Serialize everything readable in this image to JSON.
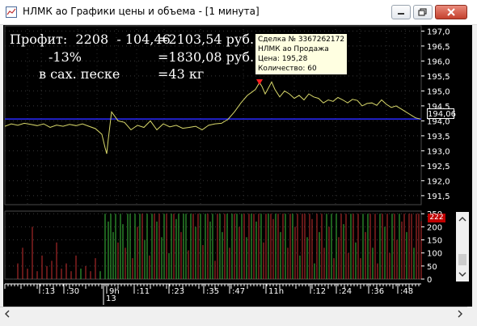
{
  "window": {
    "title": "НЛМК ао Графики цены и объема - [1 минута]"
  },
  "stats": {
    "line1_left": "Профит:  2208  - 104,46",
    "line1_right": "=2103,54 руб.",
    "line2_left": "-13%",
    "line2_right": "=1830,08 руб.",
    "line3_left": "в сах. песке",
    "line3_right": "=43 кг"
  },
  "tooltip": {
    "deal": "Сделка № 3367262172",
    "instrument": "НЛМК ао Продажа",
    "price": "Цена: 195,28",
    "quantity": "Количество: 60"
  },
  "price_axis": {
    "ticks": [
      "197,0",
      "196,5",
      "196,0",
      "195,5",
      "195,0",
      "194,5",
      "194,0",
      "193,5",
      "193,0",
      "192,5",
      "192,0",
      "191,5"
    ],
    "current": "194,06"
  },
  "volume_axis": {
    "ticks": [
      "250",
      "200",
      "150",
      "100",
      "50",
      "0"
    ],
    "current": "222"
  },
  "time_axis": {
    "labels": [
      ":13",
      ":30",
      "9h",
      ":11",
      ":23",
      ":35",
      ":47",
      "11h",
      ":12",
      ":24",
      ":36",
      ":48"
    ],
    "day": "13"
  },
  "colors": {
    "background": "#000000",
    "price_line": "#d8d86a",
    "reference_line": "#2a2aff",
    "volume_buy": "#3cc03c",
    "volume_sell": "#c83030",
    "tooltip_bg": "#ffffe1"
  },
  "chart_data": {
    "type": "line",
    "price": {
      "ylim": [
        191.2,
        197.2
      ],
      "reference": 194.06,
      "marker": 195.28,
      "x": [
        0,
        8,
        16,
        24,
        32,
        40,
        48,
        56,
        64,
        72,
        80,
        88,
        96,
        104,
        112,
        120,
        124,
        126,
        128,
        132,
        136,
        140,
        148,
        156,
        164,
        172,
        180,
        188,
        196,
        204,
        212,
        220,
        228,
        236,
        244,
        252,
        260,
        268,
        276,
        284,
        292,
        300,
        305,
        310,
        315,
        318,
        322,
        326,
        330,
        334,
        340,
        346,
        352,
        358,
        364,
        370,
        376,
        382,
        388,
        394,
        400,
        406,
        412,
        418,
        424,
        430,
        436,
        442,
        448,
        454,
        460,
        466,
        472,
        478,
        484,
        490,
        496,
        502,
        508,
        514
      ],
      "values": [
        193.82,
        193.9,
        193.85,
        193.92,
        193.88,
        193.84,
        193.9,
        193.78,
        193.86,
        193.82,
        193.88,
        193.84,
        193.9,
        193.82,
        193.74,
        193.55,
        193.1,
        192.9,
        193.4,
        194.3,
        194.15,
        194.0,
        193.95,
        193.7,
        193.85,
        193.78,
        194.0,
        193.7,
        193.9,
        193.8,
        193.85,
        193.75,
        193.78,
        193.82,
        193.7,
        193.85,
        193.9,
        193.92,
        194.05,
        194.3,
        194.6,
        194.85,
        194.95,
        195.05,
        195.28,
        195.15,
        194.9,
        195.1,
        195.3,
        195.05,
        194.8,
        195.0,
        194.9,
        194.75,
        194.85,
        194.7,
        194.9,
        194.8,
        194.75,
        194.6,
        194.7,
        194.65,
        194.78,
        194.7,
        194.6,
        194.72,
        194.68,
        194.5,
        194.58,
        194.6,
        194.52,
        194.7,
        194.55,
        194.45,
        194.5,
        194.4,
        194.3,
        194.2,
        194.1,
        194.06
      ]
    },
    "volume": {
      "ylim": [
        0,
        260
      ],
      "bars": [
        [
          16,
          60,
          "s"
        ],
        [
          22,
          120,
          "s"
        ],
        [
          28,
          40,
          "s"
        ],
        [
          34,
          200,
          "s"
        ],
        [
          40,
          30,
          "s"
        ],
        [
          46,
          90,
          "s"
        ],
        [
          52,
          50,
          "s"
        ],
        [
          58,
          70,
          "s"
        ],
        [
          64,
          140,
          "s"
        ],
        [
          70,
          40,
          "s"
        ],
        [
          76,
          60,
          "s"
        ],
        [
          82,
          30,
          "s"
        ],
        [
          88,
          90,
          "s"
        ],
        [
          94,
          40,
          "b"
        ],
        [
          100,
          50,
          "s"
        ],
        [
          106,
          30,
          "s"
        ],
        [
          112,
          80,
          "s"
        ],
        [
          118,
          30,
          "b"
        ],
        [
          124,
          250,
          "b"
        ],
        [
          128,
          220,
          "b"
        ],
        [
          131,
          250,
          "b"
        ],
        [
          134,
          180,
          "b"
        ],
        [
          137,
          250,
          "b"
        ],
        [
          140,
          140,
          "s"
        ],
        [
          143,
          250,
          "b"
        ],
        [
          146,
          210,
          "b"
        ],
        [
          149,
          120,
          "s"
        ],
        [
          152,
          250,
          "b"
        ],
        [
          155,
          250,
          "b"
        ],
        [
          158,
          80,
          "s"
        ],
        [
          161,
          250,
          "b"
        ],
        [
          164,
          200,
          "s"
        ],
        [
          167,
          250,
          "b"
        ],
        [
          170,
          250,
          "s"
        ],
        [
          173,
          150,
          "b"
        ],
        [
          176,
          250,
          "b"
        ],
        [
          179,
          90,
          "s"
        ],
        [
          182,
          250,
          "b"
        ],
        [
          185,
          250,
          "s"
        ],
        [
          188,
          220,
          "b"
        ],
        [
          191,
          250,
          "s"
        ],
        [
          194,
          160,
          "b"
        ],
        [
          197,
          250,
          "b"
        ],
        [
          200,
          250,
          "s"
        ],
        [
          203,
          100,
          "b"
        ],
        [
          206,
          250,
          "b"
        ],
        [
          209,
          250,
          "s"
        ],
        [
          212,
          230,
          "b"
        ],
        [
          215,
          250,
          "b"
        ],
        [
          218,
          180,
          "s"
        ],
        [
          221,
          250,
          "b"
        ],
        [
          224,
          250,
          "b"
        ],
        [
          227,
          110,
          "s"
        ],
        [
          230,
          250,
          "b"
        ],
        [
          233,
          250,
          "s"
        ],
        [
          236,
          200,
          "b"
        ],
        [
          239,
          250,
          "s"
        ],
        [
          242,
          250,
          "b"
        ],
        [
          245,
          130,
          "s"
        ],
        [
          248,
          250,
          "b"
        ],
        [
          251,
          250,
          "s"
        ],
        [
          254,
          220,
          "b"
        ],
        [
          257,
          250,
          "b"
        ],
        [
          260,
          70,
          "s"
        ],
        [
          263,
          250,
          "s"
        ],
        [
          266,
          250,
          "b"
        ],
        [
          269,
          180,
          "b"
        ],
        [
          272,
          250,
          "s"
        ],
        [
          275,
          250,
          "b"
        ],
        [
          278,
          120,
          "s"
        ],
        [
          281,
          250,
          "b"
        ],
        [
          284,
          250,
          "s"
        ],
        [
          287,
          250,
          "b"
        ],
        [
          290,
          200,
          "s"
        ],
        [
          293,
          250,
          "b"
        ],
        [
          296,
          250,
          "s"
        ],
        [
          299,
          160,
          "b"
        ],
        [
          302,
          250,
          "s"
        ],
        [
          305,
          250,
          "b"
        ],
        [
          308,
          250,
          "s"
        ],
        [
          311,
          220,
          "b"
        ],
        [
          314,
          250,
          "s"
        ],
        [
          317,
          250,
          "b"
        ],
        [
          320,
          140,
          "s"
        ],
        [
          323,
          250,
          "s"
        ],
        [
          326,
          250,
          "b"
        ],
        [
          329,
          250,
          "s"
        ],
        [
          332,
          230,
          "s"
        ],
        [
          335,
          250,
          "b"
        ],
        [
          338,
          250,
          "s"
        ],
        [
          341,
          180,
          "b"
        ],
        [
          344,
          250,
          "s"
        ],
        [
          347,
          250,
          "b"
        ],
        [
          350,
          120,
          "s"
        ],
        [
          353,
          250,
          "s"
        ],
        [
          356,
          250,
          "b"
        ],
        [
          359,
          200,
          "s"
        ],
        [
          362,
          250,
          "s"
        ],
        [
          365,
          90,
          "b"
        ],
        [
          368,
          250,
          "s"
        ],
        [
          371,
          250,
          "s"
        ],
        [
          374,
          160,
          "b"
        ],
        [
          377,
          250,
          "s"
        ],
        [
          380,
          230,
          "s"
        ],
        [
          383,
          60,
          "b"
        ],
        [
          386,
          250,
          "s"
        ],
        [
          389,
          180,
          "b"
        ],
        [
          392,
          250,
          "s"
        ],
        [
          395,
          120,
          "s"
        ],
        [
          398,
          250,
          "b"
        ],
        [
          401,
          200,
          "s"
        ],
        [
          404,
          250,
          "b"
        ],
        [
          407,
          80,
          "s"
        ],
        [
          410,
          250,
          "b"
        ],
        [
          413,
          160,
          "s"
        ],
        [
          416,
          250,
          "s"
        ],
        [
          419,
          210,
          "b"
        ],
        [
          422,
          250,
          "s"
        ],
        [
          425,
          100,
          "s"
        ],
        [
          428,
          250,
          "b"
        ],
        [
          431,
          250,
          "s"
        ],
        [
          434,
          140,
          "b"
        ],
        [
          437,
          250,
          "s"
        ],
        [
          440,
          80,
          "s"
        ],
        [
          443,
          250,
          "b"
        ],
        [
          446,
          180,
          "s"
        ],
        [
          449,
          250,
          "b"
        ],
        [
          452,
          250,
          "s"
        ],
        [
          455,
          120,
          "b"
        ],
        [
          458,
          250,
          "s"
        ],
        [
          461,
          60,
          "s"
        ],
        [
          464,
          250,
          "b"
        ],
        [
          467,
          250,
          "s"
        ],
        [
          470,
          200,
          "b"
        ],
        [
          473,
          250,
          "s"
        ],
        [
          476,
          100,
          "s"
        ],
        [
          479,
          250,
          "b"
        ],
        [
          482,
          250,
          "s"
        ],
        [
          485,
          150,
          "s"
        ],
        [
          488,
          250,
          "b"
        ],
        [
          491,
          220,
          "s"
        ],
        [
          494,
          250,
          "s"
        ],
        [
          497,
          180,
          "b"
        ],
        [
          500,
          250,
          "s"
        ],
        [
          503,
          250,
          "s"
        ],
        [
          506,
          120,
          "b"
        ],
        [
          509,
          250,
          "s"
        ],
        [
          512,
          250,
          "s"
        ],
        [
          515,
          222,
          "s"
        ]
      ]
    }
  }
}
